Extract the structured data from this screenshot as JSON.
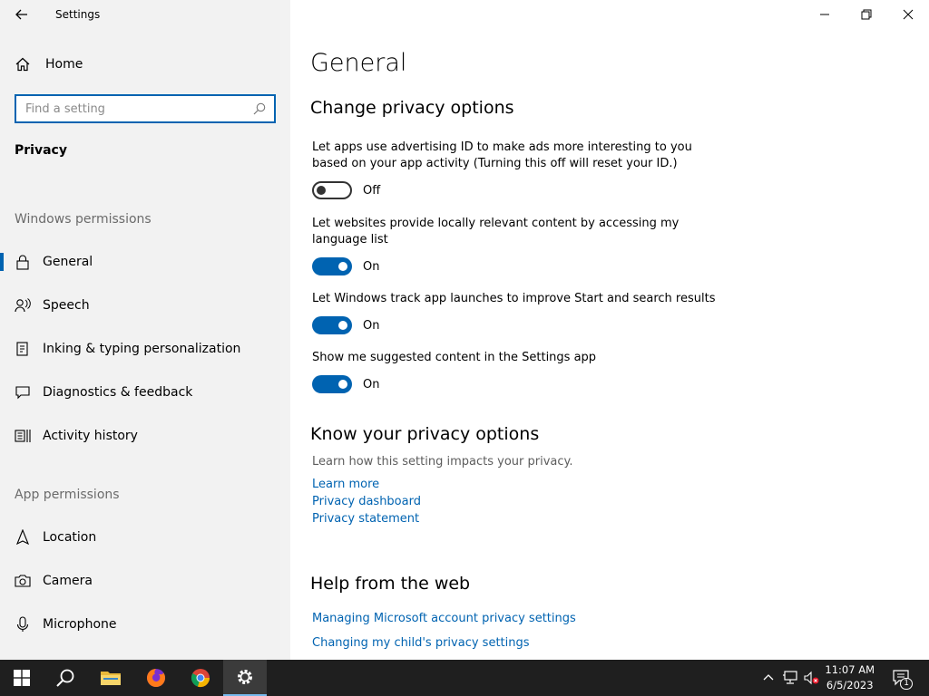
{
  "window": {
    "title": "Settings"
  },
  "sidebar": {
    "home_label": "Home",
    "search_placeholder": "Find a setting",
    "section": "Privacy",
    "group_windows": "Windows permissions",
    "group_app": "App permissions",
    "items": [
      {
        "label": "General",
        "icon": "lock-icon"
      },
      {
        "label": "Speech",
        "icon": "speech-icon"
      },
      {
        "label": "Inking & typing personalization",
        "icon": "inking-icon"
      },
      {
        "label": "Diagnostics & feedback",
        "icon": "diagnostics-icon"
      },
      {
        "label": "Activity history",
        "icon": "activity-history-icon"
      },
      {
        "label": "Location",
        "icon": "location-icon"
      },
      {
        "label": "Camera",
        "icon": "camera-icon"
      },
      {
        "label": "Microphone",
        "icon": "microphone-icon"
      }
    ]
  },
  "main": {
    "title": "General",
    "change_heading": "Change privacy options",
    "options": [
      {
        "text": "Let apps use advertising ID to make ads more interesting to you based on your app activity (Turning this off will reset your ID.)",
        "state": "Off"
      },
      {
        "text": "Let websites provide locally relevant content by accessing my language list",
        "state": "On"
      },
      {
        "text": "Let Windows track app launches to improve Start and search results",
        "state": "On"
      },
      {
        "text": "Show me suggested content in the Settings app",
        "state": "On"
      }
    ],
    "know_heading": "Know your privacy options",
    "know_desc": "Learn how this setting impacts your privacy.",
    "links": [
      "Learn more",
      "Privacy dashboard",
      "Privacy statement"
    ],
    "help_heading": "Help from the web",
    "help_links": [
      "Managing Microsoft account privacy settings",
      "Changing my child's privacy settings"
    ]
  },
  "taskbar": {
    "time": "11:07 AM",
    "date": "6/5/2023",
    "notifications": "1"
  },
  "colors": {
    "accent": "#0063b1",
    "sidebar_bg": "#f2f2f2",
    "taskbar_bg": "#1f1f1f"
  }
}
